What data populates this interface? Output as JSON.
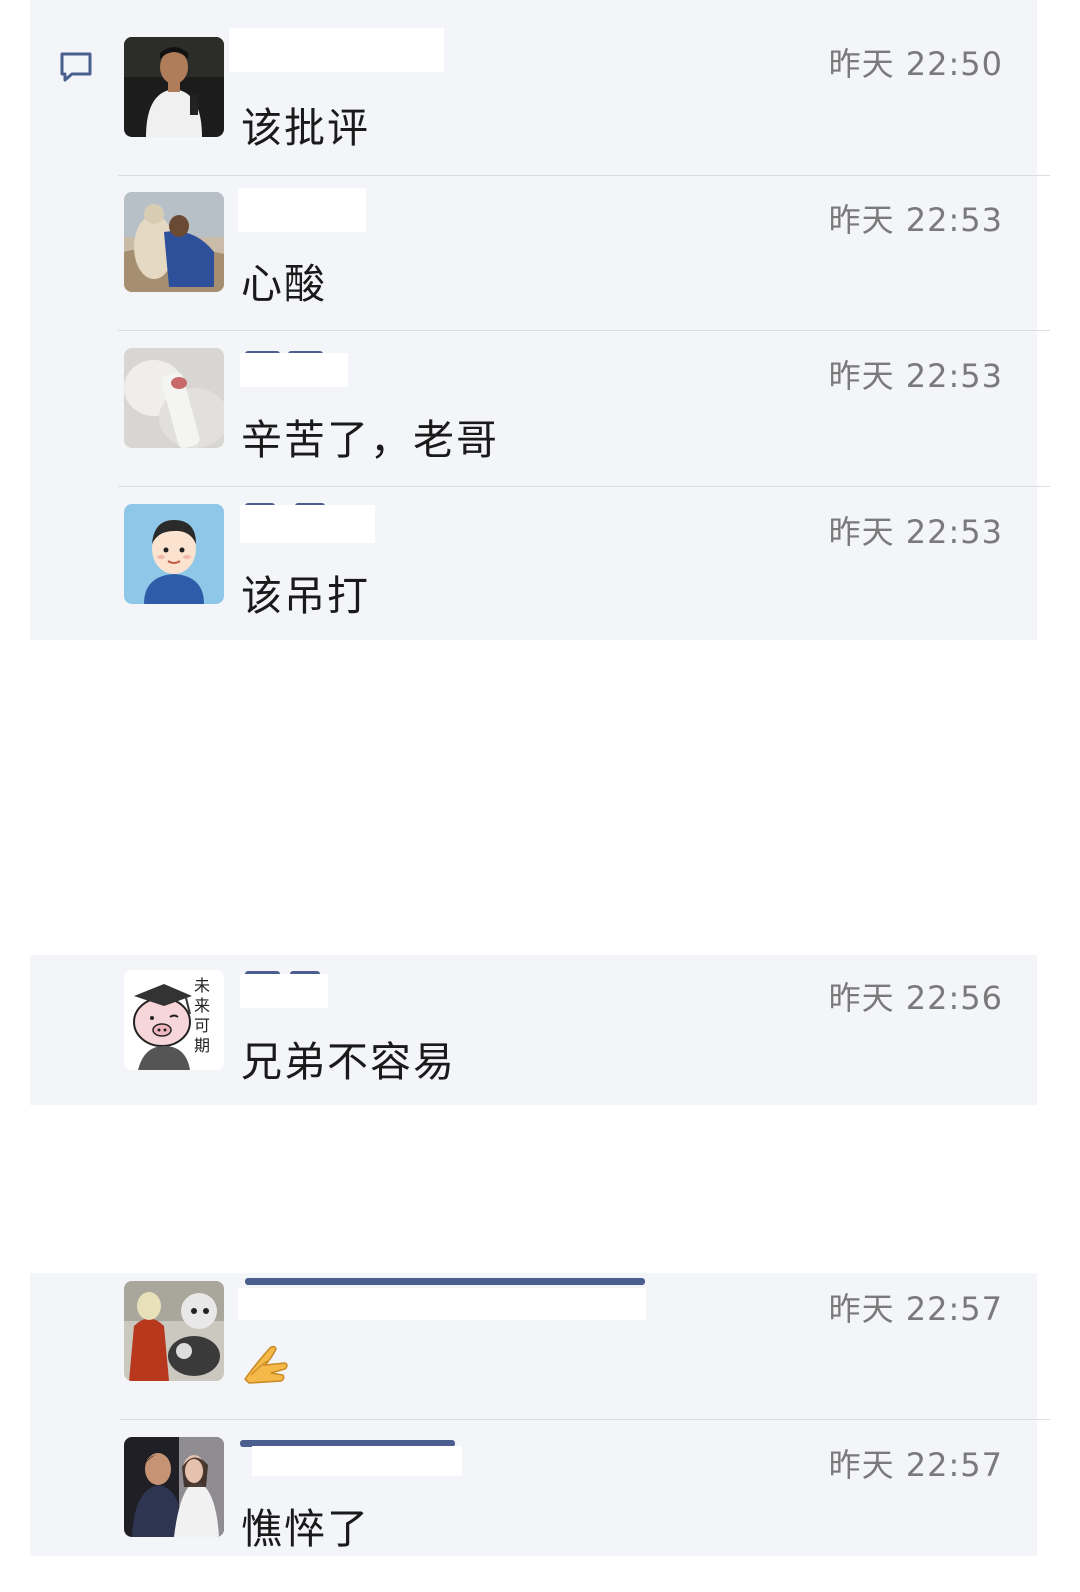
{
  "comments": [
    {
      "avatar": "man-portrait-avatar",
      "time": "昨天 22:50",
      "message": "该批评"
    },
    {
      "avatar": "hugging-dog-avatar",
      "time": "昨天 22:53",
      "message": "心酸"
    },
    {
      "avatar": "cat-paw-avatar",
      "time": "昨天 22:53",
      "message": "辛苦了，老哥"
    },
    {
      "avatar": "cartoon-boy-avatar",
      "time": "昨天 22:53",
      "message": "该吊打"
    },
    {
      "avatar": "pig-graduate-avatar",
      "time": "昨天 22:56",
      "message": "兄弟不容易",
      "avatar_text": "未来可期"
    },
    {
      "avatar": "anime-characters-avatar",
      "time": "昨天 22:57",
      "message": "",
      "emoji": "clap-hand-emoji"
    },
    {
      "avatar": "wedding-couple-avatar",
      "time": "昨天 22:57",
      "message": "憔悴了"
    }
  ],
  "icons": {
    "comment": "comment-bubble-icon"
  },
  "colors": {
    "panel": "#f4f5f8",
    "time": "#7a7a7a",
    "text": "#1a1a1a",
    "name_trace": "#4a5f8f"
  }
}
